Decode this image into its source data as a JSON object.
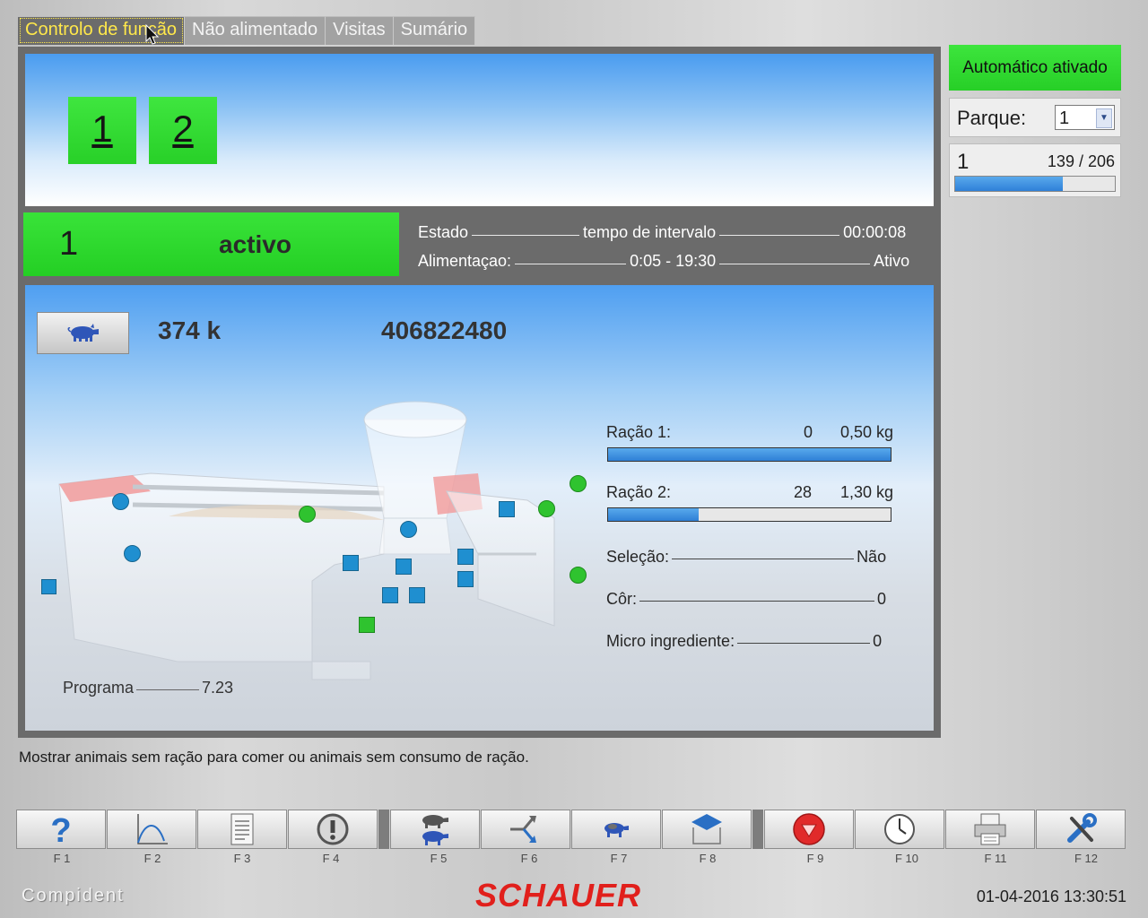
{
  "tabs": [
    "Controlo de função",
    "Não alimentado",
    "Visitas",
    "Sumário"
  ],
  "units": [
    "1",
    "2"
  ],
  "status": {
    "station": "1",
    "state_text": "activo",
    "estado_label": "Estado",
    "interval_label": "tempo de intervalo",
    "interval_value": "00:00:08",
    "alim_label": "Alimentaçao:",
    "alim_time": "0:05 - 19:30",
    "alim_state": "Ativo"
  },
  "right_panel": {
    "auto_label": "Automático ativado",
    "parque_label": "Parque:",
    "parque_value": "1",
    "counter_label": "1",
    "counter_value": "139 / 206",
    "counter_fraction": 0.675
  },
  "animal": {
    "weight": "374 k",
    "id": "406822480"
  },
  "rations": [
    {
      "label": "Ração 1:",
      "count": "0",
      "amount": "0,50 kg",
      "fill": 1.0
    },
    {
      "label": "Ração 2:",
      "count": "28",
      "amount": "1,30 kg",
      "fill": 0.32
    }
  ],
  "info": {
    "selecao_label": "Seleção:",
    "selecao_value": "Não",
    "cor_label": "Côr:",
    "cor_value": "0",
    "micro_label": "Micro ingrediente:",
    "micro_value": "0",
    "programa_label": "Programa",
    "programa_value": "7.23"
  },
  "footnote": "Mostrar animais sem ração para comer ou animais sem consumo de ração.",
  "function_keys": [
    {
      "label": "F 1",
      "icon": "help-icon"
    },
    {
      "label": "F 2",
      "icon": "curve-chart-icon"
    },
    {
      "label": "F 3",
      "icon": "document-icon"
    },
    {
      "label": "F 4",
      "icon": "alert-icon"
    },
    {
      "label": "F 5",
      "icon": "pigs-icon"
    },
    {
      "label": "F 6",
      "icon": "split-arrow-icon"
    },
    {
      "label": "F 7",
      "icon": "pig-icon"
    },
    {
      "label": "F 8",
      "icon": "feeder-icon"
    },
    {
      "label": "F 9",
      "icon": "stop-icon"
    },
    {
      "label": "F 10",
      "icon": "clock-icon"
    },
    {
      "label": "F 11",
      "icon": "printer-icon"
    },
    {
      "label": "F 12",
      "icon": "tools-icon"
    }
  ],
  "footer": {
    "brand": "Compident",
    "logo": "SCHAUER",
    "datetime": "01-04-2016 13:30:51"
  },
  "colors": {
    "active_green": "#2ed62e",
    "accent_blue": "#2f80d8",
    "frame_gray": "#6b6b6b",
    "logo_red": "#e1201c"
  }
}
